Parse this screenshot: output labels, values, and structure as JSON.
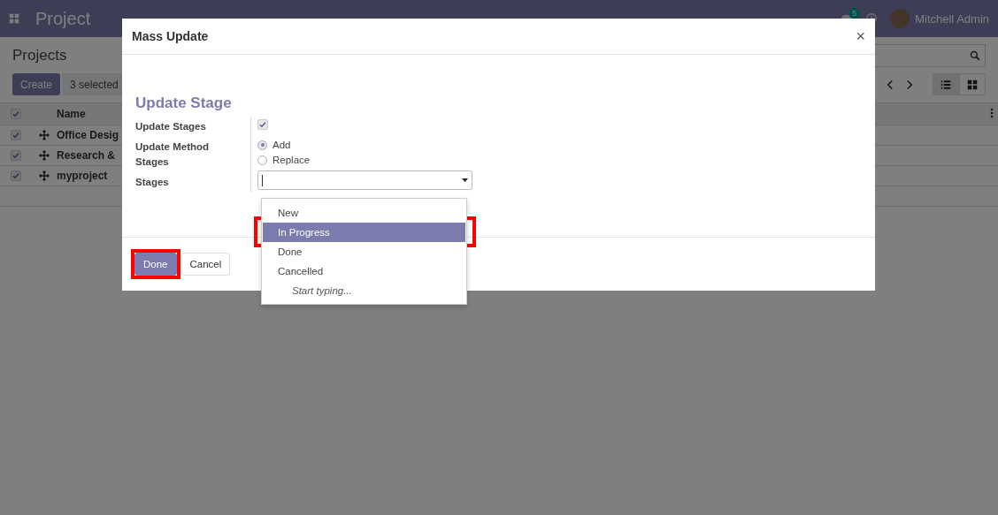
{
  "navbar": {
    "brand": "Project",
    "chat_badge": "5",
    "user": "Mitchell Admin"
  },
  "control_panel": {
    "title": "Projects",
    "create_button": "Create",
    "selection": "3 selected"
  },
  "table": {
    "columns": [
      "Name"
    ],
    "rows": [
      {
        "name": "Office Desig",
        "checked": true
      },
      {
        "name": "Research &",
        "checked": true
      },
      {
        "name": "myproject",
        "checked": true
      }
    ],
    "all_checked": true
  },
  "dialog": {
    "title": "Mass Update",
    "close": "×",
    "heading": "Update Stage",
    "fields": [
      {
        "kind": "checkbox",
        "label": "Update Stages",
        "checked": true
      },
      {
        "kind": "radio",
        "label": "Update Method Stages",
        "options": [
          {
            "label": "Add",
            "selected": true
          },
          {
            "label": "Replace",
            "selected": false
          }
        ]
      },
      {
        "kind": "select",
        "label": "Stages"
      }
    ],
    "dropdown": {
      "options": [
        {
          "label": "New",
          "selected": false,
          "highlighted": false
        },
        {
          "label": "In Progress",
          "selected": true,
          "highlighted": true
        },
        {
          "label": "Done",
          "selected": false,
          "highlighted": false
        },
        {
          "label": "Cancelled",
          "selected": false,
          "highlighted": false
        }
      ],
      "hint": "Start typing..."
    },
    "buttons": [
      {
        "label": "Done",
        "kind": "primary",
        "highlighted": true
      },
      {
        "label": "Cancel",
        "kind": "secondary",
        "highlighted": false
      }
    ]
  }
}
